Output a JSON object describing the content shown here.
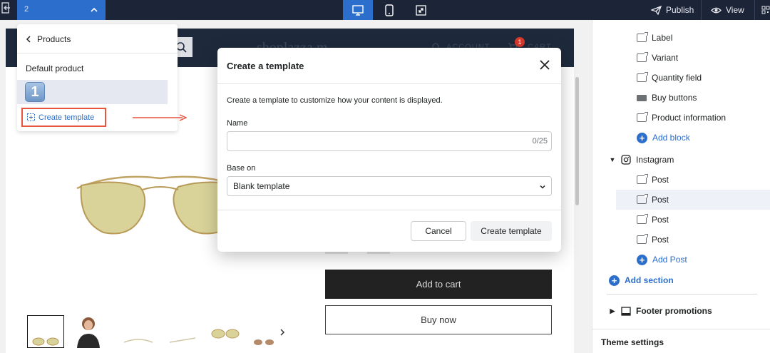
{
  "topbar": {
    "page_number": "2",
    "publish_label": "Publish",
    "view_label": "View"
  },
  "store": {
    "logo": "shoplazza m",
    "account_label": "ACCOUNT",
    "cart_label": "CART",
    "cart_count": "1",
    "add_to_cart_label": "Add to cart",
    "buy_now_label": "Buy now"
  },
  "dropdown": {
    "back_label": "Products",
    "default_label": "Default product",
    "step_number": "1",
    "create_label": "Create template"
  },
  "sidebar": {
    "items": [
      {
        "label": "Label",
        "icon": "block-icon"
      },
      {
        "label": "Variant",
        "icon": "block-icon"
      },
      {
        "label": "Quantity field",
        "icon": "block-icon"
      },
      {
        "label": "Buy buttons",
        "icon": "button-block-icon"
      },
      {
        "label": "Product information",
        "icon": "block-icon"
      }
    ],
    "add_block_label": "Add block",
    "instagram_label": "Instagram",
    "posts": [
      "Post",
      "Post",
      "Post",
      "Post"
    ],
    "add_post_label": "Add Post",
    "add_section_label": "Add section",
    "footer_label": "Footer promotions",
    "theme_settings_label": "Theme settings"
  },
  "modal": {
    "title": "Create a template",
    "description": "Create a template to customize how your content is displayed.",
    "name_label": "Name",
    "name_value": "",
    "name_counter": "0/25",
    "base_label": "Base on",
    "base_value": "Blank template",
    "cancel_label": "Cancel",
    "create_label": "Create template"
  },
  "colors": {
    "accent": "#2c6ecb",
    "topbar_bg": "#1c2438",
    "highlight_border": "#e7553e"
  }
}
